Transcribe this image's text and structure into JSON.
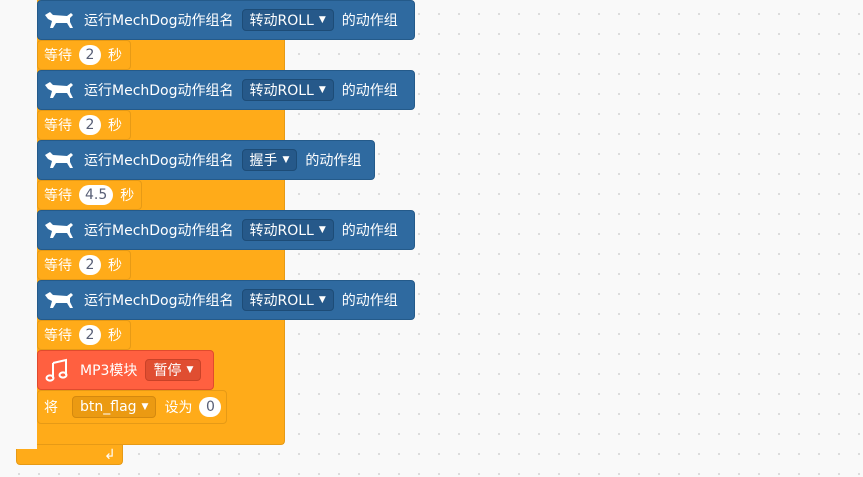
{
  "blocks": {
    "mechdog_1": {
      "label": "运行MechDog动作组名",
      "value": "转动ROLL",
      "suffix": "的动作组"
    },
    "wait_1": {
      "label": "等待",
      "value": "2",
      "unit": "秒"
    },
    "mechdog_2": {
      "label": "运行MechDog动作组名",
      "value": "转动ROLL",
      "suffix": "的动作组"
    },
    "wait_2": {
      "label": "等待",
      "value": "2",
      "unit": "秒"
    },
    "mechdog_3": {
      "label": "运行MechDog动作组名",
      "value": "握手",
      "suffix": "的动作组"
    },
    "wait_3": {
      "label": "等待",
      "value": "4.5",
      "unit": "秒"
    },
    "mechdog_4": {
      "label": "运行MechDog动作组名",
      "value": "转动ROLL",
      "suffix": "的动作组"
    },
    "wait_4": {
      "label": "等待",
      "value": "2",
      "unit": "秒"
    },
    "mechdog_5": {
      "label": "运行MechDog动作组名",
      "value": "转动ROLL",
      "suffix": "的动作组"
    },
    "wait_5": {
      "label": "等待",
      "value": "2",
      "unit": "秒"
    },
    "mp3": {
      "label": "MP3模块",
      "value": "暂停"
    },
    "set_var": {
      "prefix": "将",
      "variable": "btn_flag",
      "middle": "设为",
      "value": "0"
    }
  },
  "colors": {
    "mechdog_block": "#2f6aa0",
    "control_block": "#ffab19",
    "sound_block": "#ff6040",
    "workspace": "#f9f9f9"
  },
  "icons": {
    "mechdog": "dog-icon",
    "mp3": "music-note-icon",
    "loop": "loop-arrow-icon",
    "dropdown": "caret-down-icon"
  }
}
